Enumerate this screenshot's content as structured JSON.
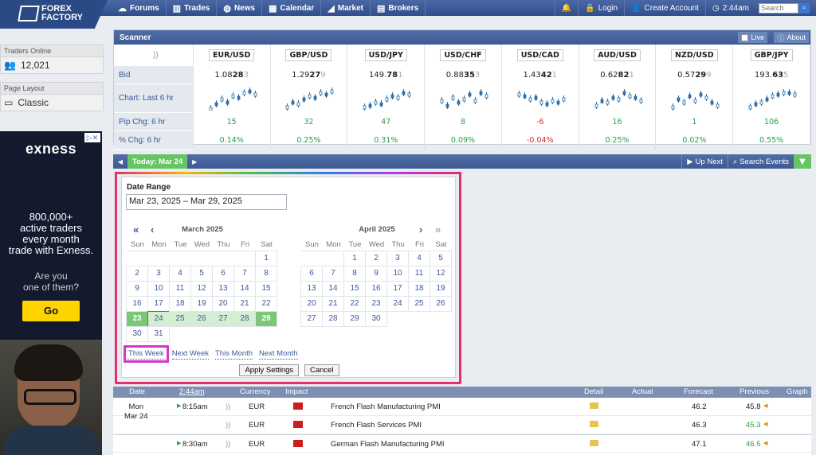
{
  "logo": {
    "line1": "FOREX",
    "line2": "FACTORY"
  },
  "nav": [
    {
      "icon": "forums-icon",
      "glyph": "☁",
      "label": "Forums"
    },
    {
      "icon": "trades-icon",
      "glyph": "▥",
      "label": "Trades"
    },
    {
      "icon": "news-icon",
      "glyph": "◍",
      "label": "News"
    },
    {
      "icon": "calendar-icon",
      "glyph": "▦",
      "label": "Calendar"
    },
    {
      "icon": "market-icon",
      "glyph": "◢",
      "label": "Market"
    },
    {
      "icon": "brokers-icon",
      "glyph": "▤",
      "label": "Brokers"
    }
  ],
  "right_nav": {
    "login": "Login",
    "create_account": "Create Account",
    "time": "2:44am",
    "search_placeholder": "Search"
  },
  "sidebar": {
    "traders_online_label": "Traders Online",
    "traders_online_value": "12,021",
    "page_layout_label": "Page Layout",
    "page_layout_value": "Classic"
  },
  "ad": {
    "brand": "exness",
    "line1": "800,000+",
    "line2": "active traders",
    "line3": "every month",
    "line4": "trade with Exness.",
    "q1": "Are you",
    "q2": "one of them?",
    "cta": "Go"
  },
  "scanner": {
    "title": "Scanner",
    "live": "Live",
    "about": "About",
    "row_labels": {
      "bid": "Bid",
      "chart": "Chart: Last 6 hr",
      "pip": "Pip Chg: 6 hr",
      "pct": "% Chg: 6 hr"
    },
    "pairs": [
      {
        "pair": "EUR/USD",
        "bid_a": "1.08",
        "bid_b": "28",
        "bid_c": "3",
        "pip": "15",
        "pct": "0.14%",
        "dir": "up"
      },
      {
        "pair": "GBP/USD",
        "bid_a": "1.29",
        "bid_b": "27",
        "bid_c": "9",
        "pip": "32",
        "pct": "0.25%",
        "dir": "up"
      },
      {
        "pair": "USD/JPY",
        "bid_a": "149.",
        "bid_b": "78",
        "bid_c": "1",
        "pip": "47",
        "pct": "0.31%",
        "dir": "up"
      },
      {
        "pair": "USD/CHF",
        "bid_a": "0.88",
        "bid_b": "35",
        "bid_c": "3",
        "pip": "8",
        "pct": "0.09%",
        "dir": "up"
      },
      {
        "pair": "USD/CAD",
        "bid_a": "1.43",
        "bid_b": "42",
        "bid_c": "1",
        "pip": "-6",
        "pct": "-0.04%",
        "dir": "down"
      },
      {
        "pair": "AUD/USD",
        "bid_a": "0.62",
        "bid_b": "82",
        "bid_c": "1",
        "pip": "16",
        "pct": "0.25%",
        "dir": "up"
      },
      {
        "pair": "NZD/USD",
        "bid_a": "0.57",
        "bid_b": "29",
        "bid_c": "9",
        "pip": "1",
        "pct": "0.02%",
        "dir": "up"
      },
      {
        "pair": "GBP/JPY",
        "bid_a": "193.",
        "bid_b": "63",
        "bid_c": "5",
        "pip": "106",
        "pct": "0.55%",
        "dir": "up"
      }
    ]
  },
  "daybar": {
    "today": "Today: Mar 24",
    "up_next": "Up Next",
    "search_events": "Search Events"
  },
  "datepicker": {
    "label": "Date Range",
    "value": "Mar 23, 2025 – Mar 29, 2025",
    "weekdays": [
      "Sun",
      "Mon",
      "Tue",
      "Wed",
      "Thu",
      "Fri",
      "Sat"
    ],
    "month1": {
      "title": "March 2025",
      "offset": 6,
      "days": 31
    },
    "month2": {
      "title": "April 2025",
      "offset": 2,
      "days": 30
    },
    "quick": [
      "This Week",
      "Next Week",
      "This Month",
      "Next Month"
    ],
    "apply": "Apply Settings",
    "cancel": "Cancel"
  },
  "events": {
    "headers": {
      "date": "Date",
      "time": "2:44am",
      "currency": "Currency",
      "impact": "Impact",
      "detail": "Detail",
      "actual": "Actual",
      "forecast": "Forecast",
      "previous": "Previous",
      "graph": "Graph"
    },
    "day_line1": "Mon",
    "day_line2": "Mar 24",
    "rows": [
      {
        "time": "8:15am",
        "currency": "EUR",
        "event": "French Flash Manufacturing PMI",
        "forecast": "46.2",
        "previous": "45.8"
      },
      {
        "time": "",
        "currency": "EUR",
        "event": "French Flash Services PMI",
        "forecast": "46.3",
        "previous": "45.3"
      },
      {
        "time": "8:30am",
        "currency": "EUR",
        "event": "German Flash Manufacturing PMI",
        "forecast": "47.1",
        "previous": "46.5"
      }
    ]
  }
}
